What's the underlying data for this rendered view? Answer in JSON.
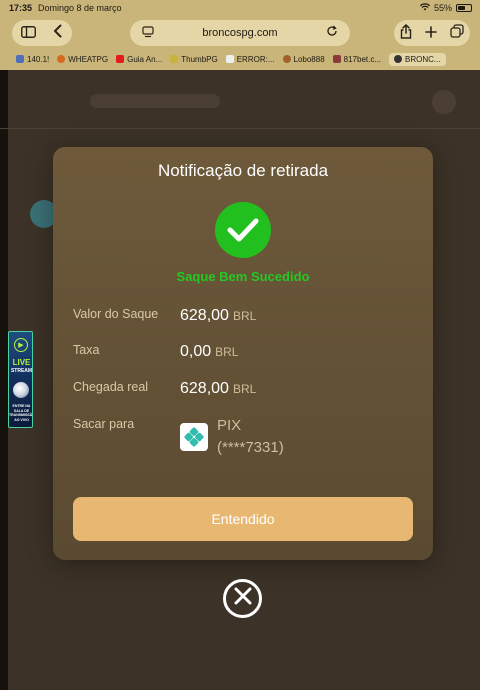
{
  "status_bar": {
    "time": "17:35",
    "date": "Domingo 8 de março",
    "battery": "55%"
  },
  "browser": {
    "url": "broncospg.com",
    "bookmarks": [
      {
        "label": "140.1!",
        "color": "#4f6fb8"
      },
      {
        "label": "WHEATPG",
        "color": "#d46a1f"
      },
      {
        "label": "Guia An...",
        "color": "#e21b1b"
      },
      {
        "label": "ThumbPG",
        "color": "#c8b43a"
      },
      {
        "label": "ERROR:...",
        "color": "#eeeeee"
      },
      {
        "label": "Lobo888",
        "color": "#a0612a"
      },
      {
        "label": "817bet.c...",
        "color": "#8a3a3a"
      },
      {
        "label": "BRONC...",
        "color": "#333333"
      }
    ]
  },
  "live_banner": {
    "title": "LIVE",
    "subtitle": "STREAM",
    "footer": "ENTRE NA SALA DE TRANSMISSÃO AO VIVO"
  },
  "modal": {
    "title": "Notificação de retirada",
    "status": "Saque Bem Sucedido",
    "rows": [
      {
        "label": "Valor do Saque",
        "value": "628,00",
        "currency": "BRL"
      },
      {
        "label": "Taxa",
        "value": "0,00",
        "currency": "BRL"
      },
      {
        "label": "Chegada real",
        "value": "628,00",
        "currency": "BRL"
      }
    ],
    "destination_label": "Sacar para",
    "destination_method": "PIX",
    "destination_account": "(****7331)",
    "confirm_label": "Entendido"
  },
  "colors": {
    "accent_button": "#e8b872",
    "success_green": "#22c01f",
    "modal_bg": "#6e5a3b"
  }
}
